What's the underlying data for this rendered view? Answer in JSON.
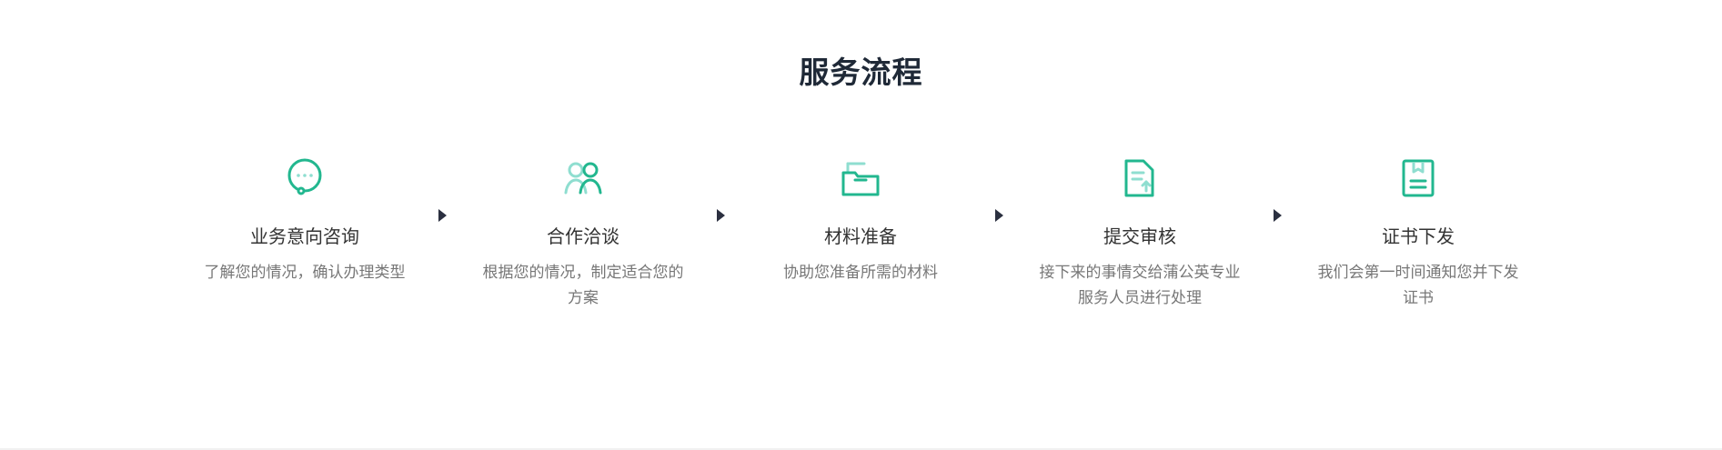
{
  "section": {
    "title": "服务流程"
  },
  "steps": [
    {
      "icon": "chat-bubble-icon",
      "title": "业务意向咨询",
      "description": "了解您的情况，确认办理类型"
    },
    {
      "icon": "users-icon",
      "title": "合作洽谈",
      "description": "根据您的情况，制定适合您的方案"
    },
    {
      "icon": "folder-icon",
      "title": "材料准备",
      "description": "协助您准备所需的材料"
    },
    {
      "icon": "document-upload-icon",
      "title": "提交审核",
      "description": "接下来的事情交给蒲公英专业服务人员进行处理"
    },
    {
      "icon": "certificate-icon",
      "title": "证书下发",
      "description": "我们会第一时间通知您并下发证书"
    }
  ],
  "colors": {
    "accent": "#22b78f",
    "accent_light": "#8fded0",
    "title": "#1f2937",
    "text": "#333333",
    "muted": "#777777",
    "arrow": "#2b3040"
  }
}
